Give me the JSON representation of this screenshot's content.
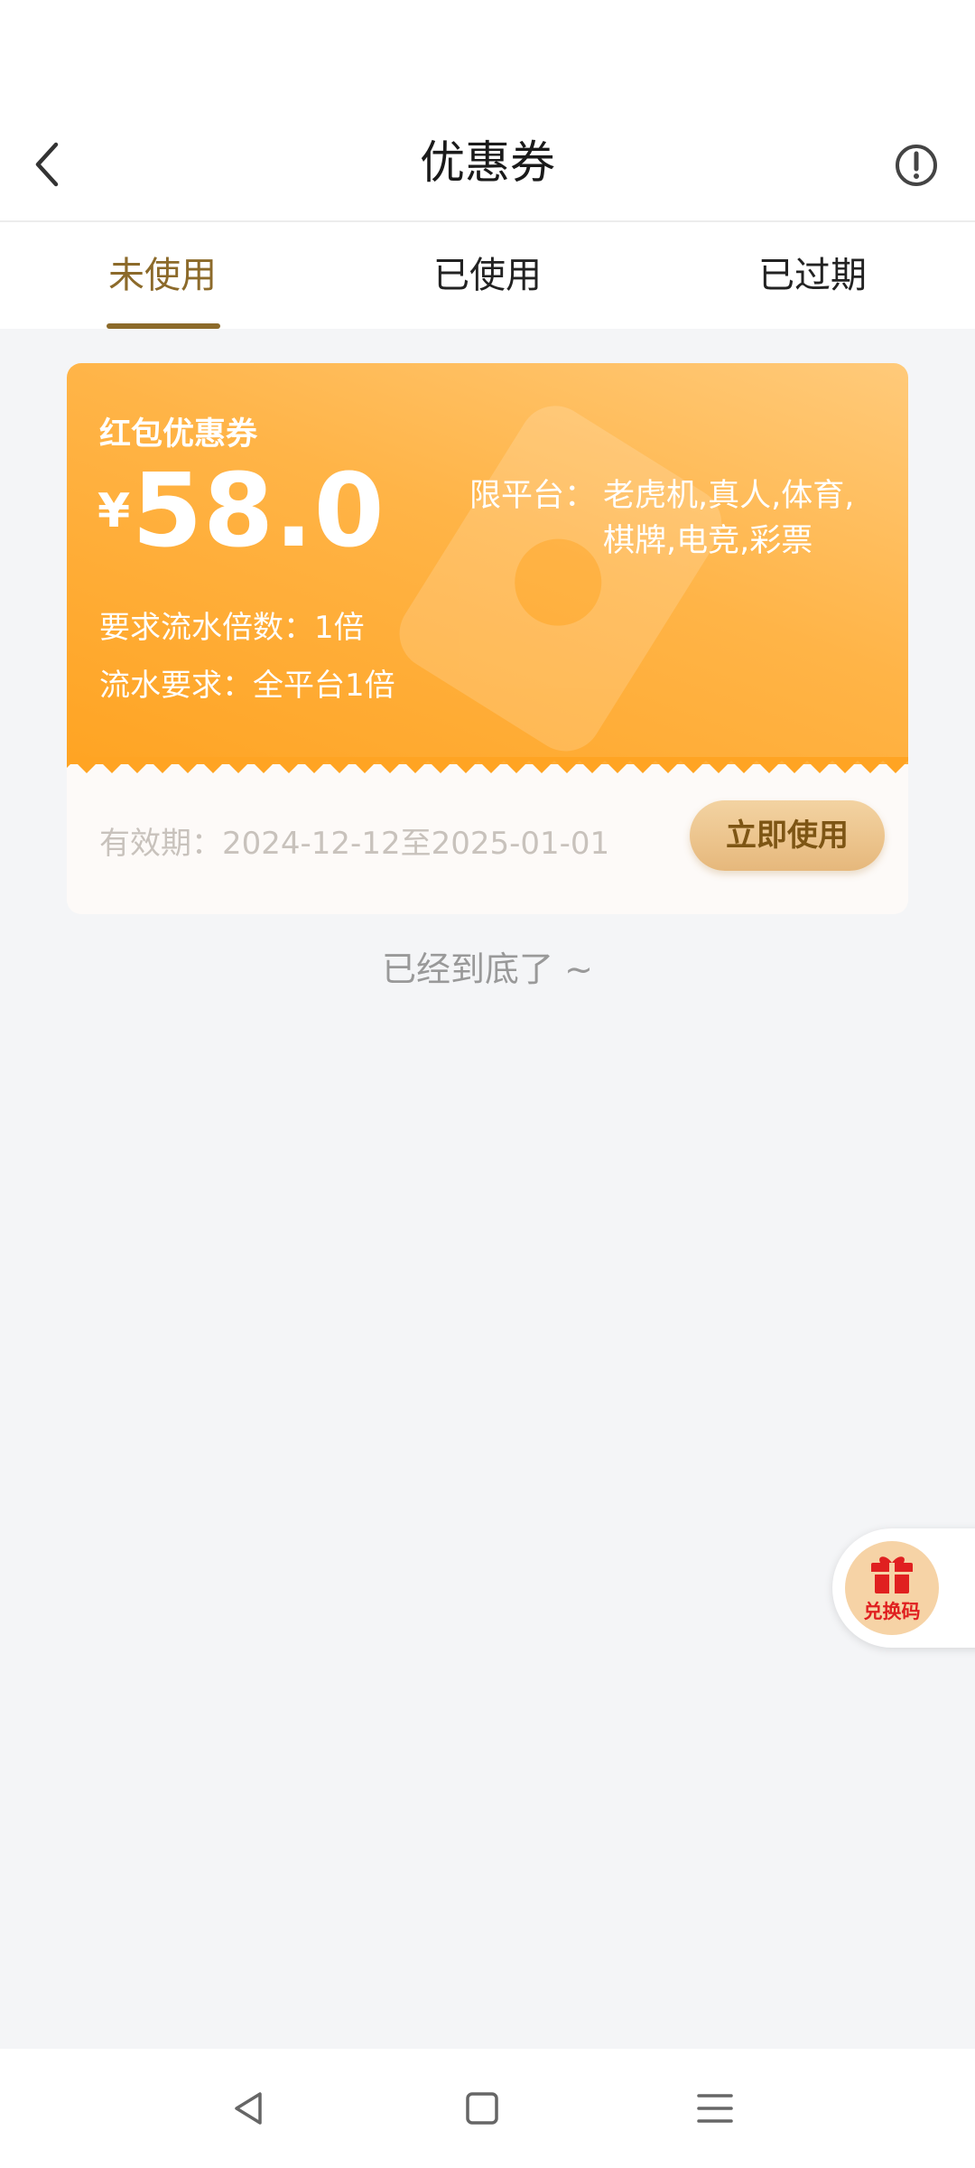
{
  "header": {
    "title": "优惠券"
  },
  "tabs": [
    {
      "label": "未使用",
      "active": true
    },
    {
      "label": "已使用",
      "active": false
    },
    {
      "label": "已过期",
      "active": false
    }
  ],
  "coupon": {
    "type_label": "红包优惠券",
    "currency": "¥",
    "amount": "58.0",
    "platform_prefix": "限平台：",
    "platform_value": "老虎机,真人,体育,棋牌,电竞,彩票",
    "turnover_multiplier": "要求流水倍数：1倍",
    "turnover_requirement": "流水要求：全平台1倍",
    "validity": "有效期：2024-12-12至2025-01-01",
    "use_button": "立即使用"
  },
  "end_text": "已经到底了 ~",
  "redeem": {
    "label": "兑换码"
  },
  "colors": {
    "accent": "#8c6a2a",
    "coupon_orange": "#ffa423",
    "redeem_red": "#e02020"
  },
  "icons": {
    "back": "chevron-left-icon",
    "info": "exclamation-circle-icon",
    "gift": "gift-icon",
    "nav_back": "triangle-back-icon",
    "nav_home": "square-home-icon",
    "nav_menu": "menu-lines-icon"
  }
}
